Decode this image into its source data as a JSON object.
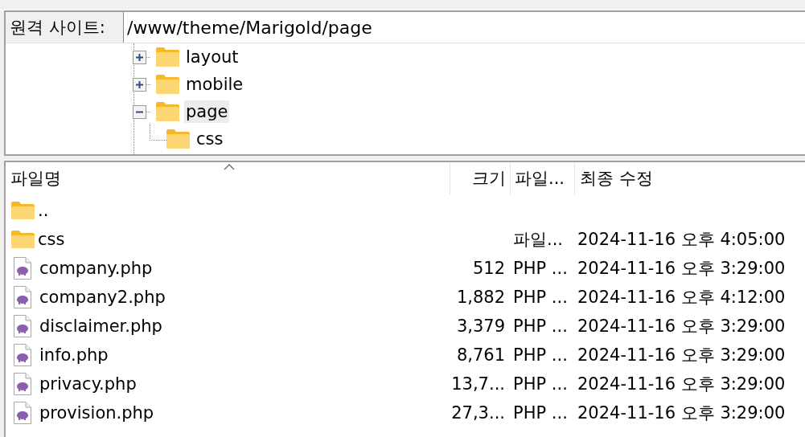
{
  "remote_site": {
    "label": "원격 사이트:",
    "path": "/www/theme/Marigold/page"
  },
  "tree": [
    {
      "label": "layout",
      "expanded": false,
      "selected": false
    },
    {
      "label": "mobile",
      "expanded": false,
      "selected": false
    },
    {
      "label": "page",
      "expanded": true,
      "selected": true,
      "children": [
        {
          "label": "css",
          "selected": false
        }
      ]
    }
  ],
  "file_list": {
    "columns": [
      "파일명",
      "크기",
      "파일...",
      "최종 수정"
    ],
    "rows": [
      {
        "kind": "folder",
        "name": ".."
      },
      {
        "kind": "folder",
        "name": "css",
        "size": "",
        "type": "파일...",
        "modified": "2024-11-16 오후 4:05:00"
      },
      {
        "kind": "php",
        "name": "company.php",
        "size": "512",
        "type": "PHP ...",
        "modified": "2024-11-16 오후 3:29:00"
      },
      {
        "kind": "php",
        "name": "company2.php",
        "size": "1,882",
        "type": "PHP ...",
        "modified": "2024-11-16 오후 4:12:00"
      },
      {
        "kind": "php",
        "name": "disclaimer.php",
        "size": "3,379",
        "type": "PHP ...",
        "modified": "2024-11-16 오후 3:29:00"
      },
      {
        "kind": "php",
        "name": "info.php",
        "size": "8,761",
        "type": "PHP ...",
        "modified": "2024-11-16 오후 3:29:00"
      },
      {
        "kind": "php",
        "name": "privacy.php",
        "size": "13,7...",
        "type": "PHP ...",
        "modified": "2024-11-16 오후 3:29:00"
      },
      {
        "kind": "php",
        "name": "provision.php",
        "size": "27,3...",
        "type": "PHP ...",
        "modified": "2024-11-16 오후 3:29:00"
      }
    ]
  }
}
